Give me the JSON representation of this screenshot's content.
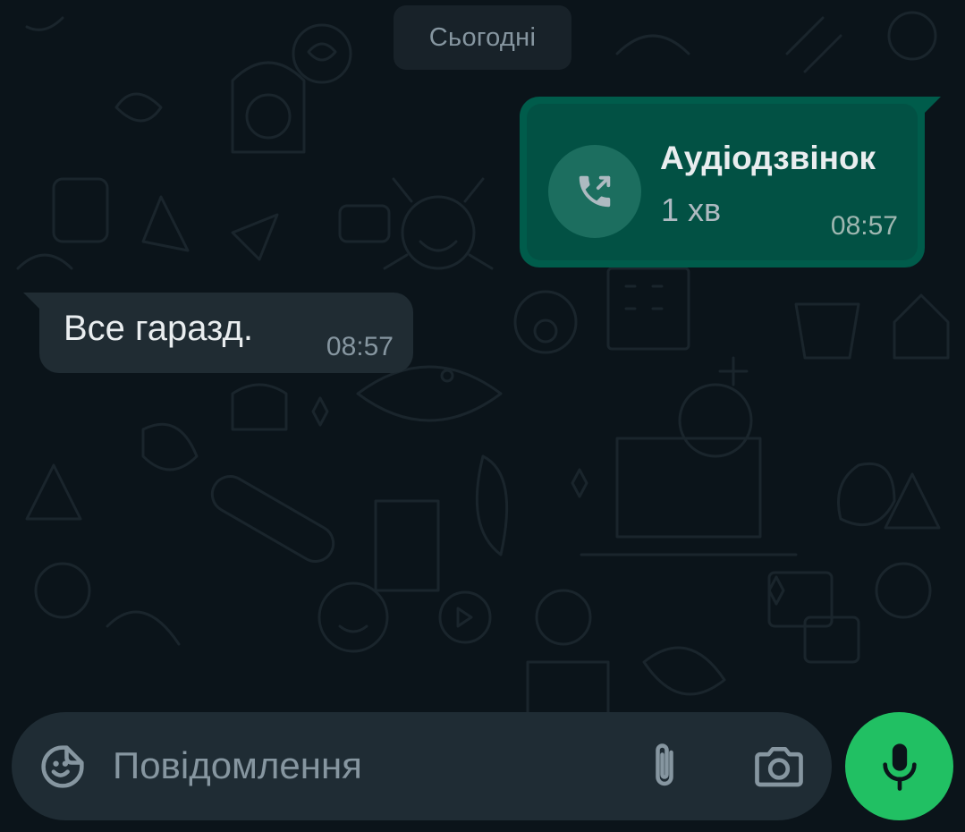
{
  "chat": {
    "date_separator": "Сьогодні",
    "outgoing_call": {
      "title": "Аудіодзвінок",
      "duration": "1 хв",
      "time": "08:57",
      "icon": "outgoing-call-icon"
    },
    "incoming_message": {
      "text": "Все гаразд.",
      "time": "08:57"
    }
  },
  "composer": {
    "placeholder": "Повідомлення",
    "emoji_icon": "sticker-smile-icon",
    "attach_icon": "paperclip-icon",
    "camera_icon": "camera-icon",
    "mic_icon": "microphone-icon"
  },
  "colors": {
    "background": "#0b141a",
    "outgoing_bubble": "#005c4b",
    "incoming_bubble": "#202c33",
    "accent": "#21c063"
  }
}
